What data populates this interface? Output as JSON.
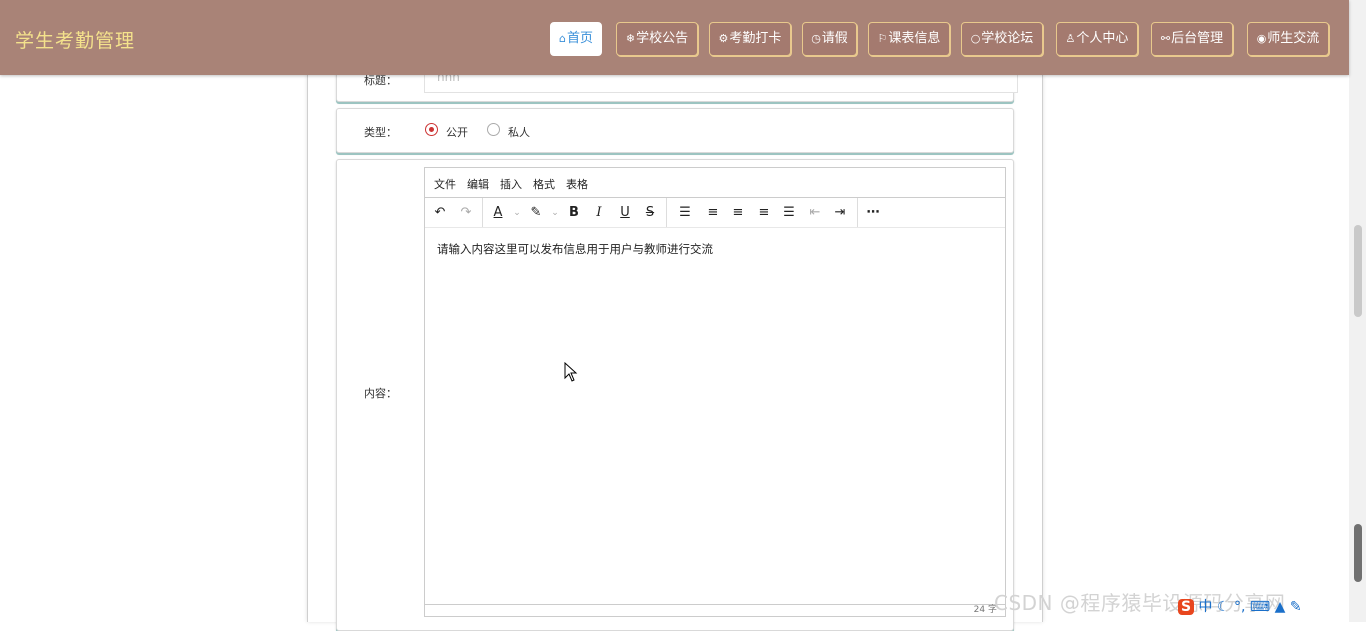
{
  "app": {
    "title": "学生考勤管理"
  },
  "nav": {
    "items": [
      {
        "icon": "⌂",
        "label": "首页",
        "active": true
      },
      {
        "icon": "❄",
        "label": "学校公告"
      },
      {
        "icon": "⚙",
        "label": "考勤打卡"
      },
      {
        "icon": "◷",
        "label": "请假"
      },
      {
        "icon": "⚐",
        "label": "课表信息"
      },
      {
        "icon": "○",
        "label": "学校论坛"
      },
      {
        "icon": "♙",
        "label": "个人中心"
      },
      {
        "icon": "⚯",
        "label": "后台管理"
      },
      {
        "icon": "◉",
        "label": "师生交流"
      }
    ]
  },
  "form": {
    "title_label": "标题：",
    "title_value": "hhh",
    "type_label": "类型：",
    "type_options": [
      "公开",
      "私人"
    ],
    "type_selected": "公开",
    "content_label": "内容："
  },
  "editor": {
    "menus": [
      "文件",
      "编辑",
      "插入",
      "格式",
      "表格"
    ],
    "content": "请输入内容这里可以发布信息用于用户与教师进行交流",
    "word_count": "24 字"
  },
  "watermark": "CSDN @程序猿毕设源码分享网",
  "tray": {
    "icons": [
      "sogou-s-icon",
      "中",
      "moon-icon",
      "comma-icon",
      "keyboard-icon",
      "shirt-icon",
      "wrench-icon"
    ],
    "ime_label": "中"
  }
}
